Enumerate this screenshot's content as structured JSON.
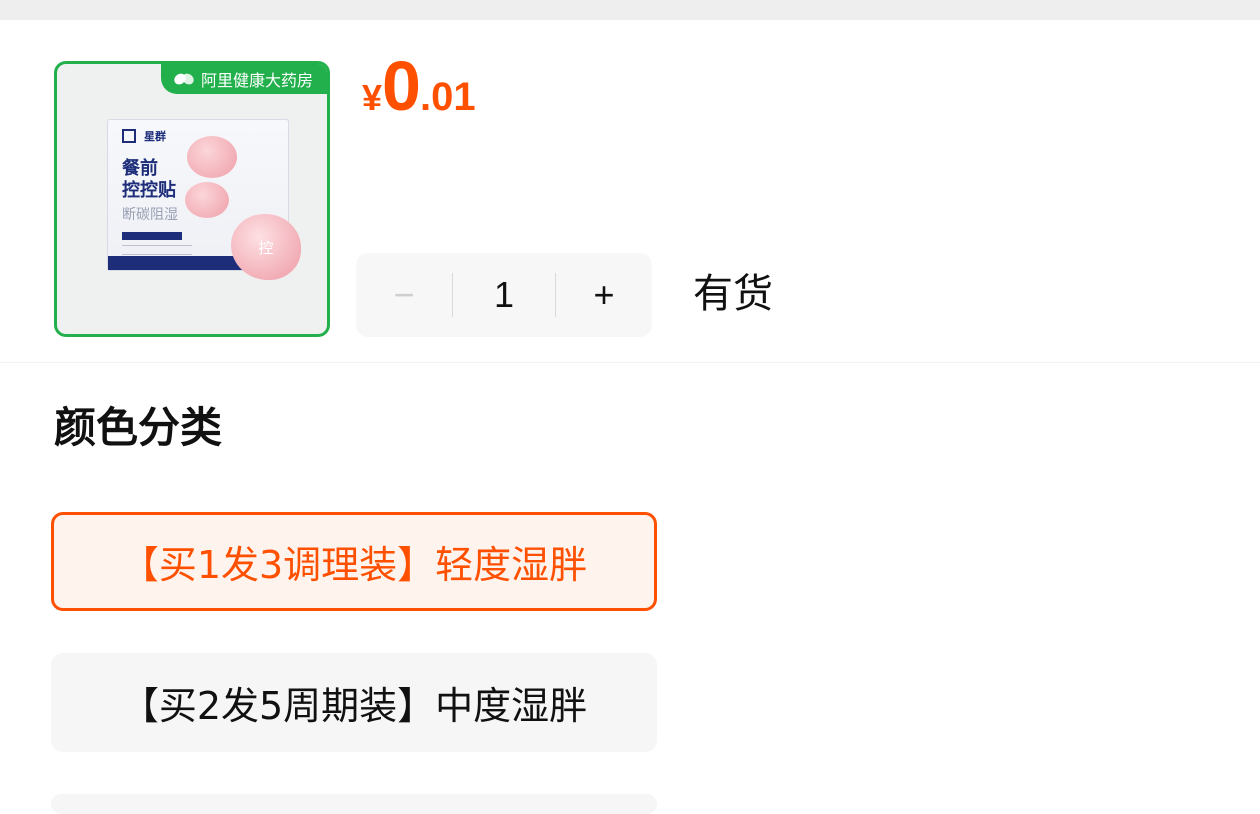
{
  "colors": {
    "price": "#ff5000",
    "badge": "#22b04c",
    "selected_border": "#ff5000",
    "selected_bg": "#fff3ee",
    "option_bg": "#f6f6f6"
  },
  "product": {
    "badge_text": "阿里健康大药房",
    "badge_icon": "pill-icon",
    "box_brand": "星群",
    "box_title": "餐前\n控控贴",
    "box_subtitle": "断碳阻湿",
    "patch_label": "控"
  },
  "price": {
    "currency": "¥",
    "integer": "0",
    "decimal": ".01"
  },
  "quantity": {
    "minus_label": "−",
    "value": "1",
    "plus_label": "+"
  },
  "stock_status": "有货",
  "section_title": "颜色分类",
  "options": [
    {
      "label": "【买1发3调理装】轻度湿胖",
      "selected": true
    },
    {
      "label": "【买2发5周期装】中度湿胖",
      "selected": false
    }
  ]
}
